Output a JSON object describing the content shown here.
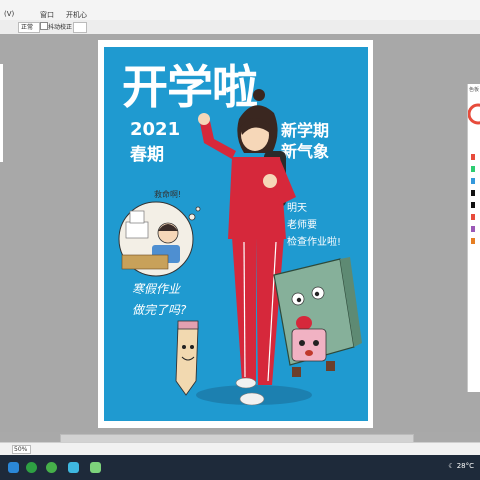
{
  "menu": {
    "items": [
      "",
      "(V)",
      "窗口",
      "开机心"
    ]
  },
  "toolbar": {
    "mode_value": "正常",
    "antialias_label": "抖动校正"
  },
  "poster": {
    "title": "开学啦",
    "year": "2021",
    "season": "春期",
    "slogan_line1": "新学期",
    "slogan_line2": "新气象",
    "teacher_lines": [
      "明天",
      "老师要",
      "检查作业啦!"
    ],
    "question_lines": [
      "寒假作业",
      "做完了吗?"
    ],
    "bubble_text": "救命啊!"
  },
  "right_panel": {
    "title": "色板"
  },
  "status": {
    "zoom": "50%"
  },
  "tray": {
    "weather_temp": "28°C"
  },
  "colors": {
    "poster_bg": "#1f9ad0",
    "jacket": "#d6283b",
    "taskbar": "#1e2a3a"
  }
}
